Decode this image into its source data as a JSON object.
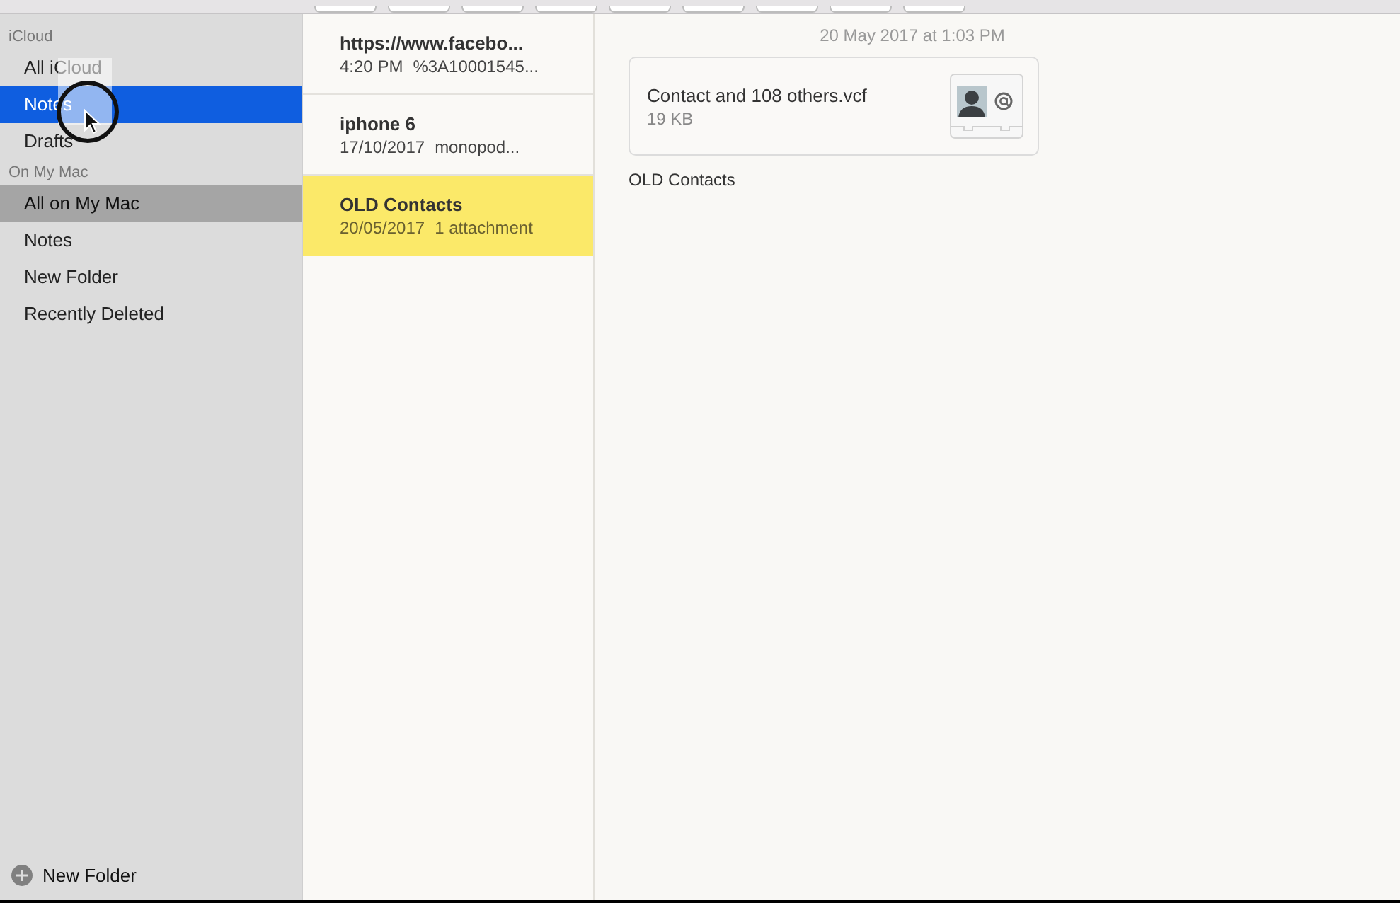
{
  "sidebar": {
    "sections": [
      {
        "title": "iCloud",
        "focused": true,
        "items": [
          {
            "label": "All iCloud",
            "selected": false
          },
          {
            "label": "Notes",
            "selected": true
          },
          {
            "label": "Drafts",
            "selected": false
          }
        ]
      },
      {
        "title": "On My Mac",
        "focused": false,
        "items": [
          {
            "label": "All on My Mac",
            "selected": true
          },
          {
            "label": "Notes",
            "selected": false
          },
          {
            "label": "New Folder",
            "selected": false
          },
          {
            "label": "Recently Deleted",
            "selected": false
          }
        ]
      }
    ],
    "new_folder_button": "New Folder"
  },
  "notes": [
    {
      "title": "https://www.facebo...",
      "date": "4:20 PM",
      "preview": "%3A10001545...",
      "selected": false
    },
    {
      "title": "iphone 6",
      "date": "17/10/2017",
      "preview": "monopod...",
      "selected": false
    },
    {
      "title": "OLD Contacts",
      "date": "20/05/2017",
      "preview": "1 attachment",
      "selected": true
    }
  ],
  "note": {
    "timestamp": "20 May 2017 at 1:03 PM",
    "attachment": {
      "name": "Contact and 108 others.vcf",
      "size": "19 KB"
    },
    "body": "OLD Contacts"
  }
}
